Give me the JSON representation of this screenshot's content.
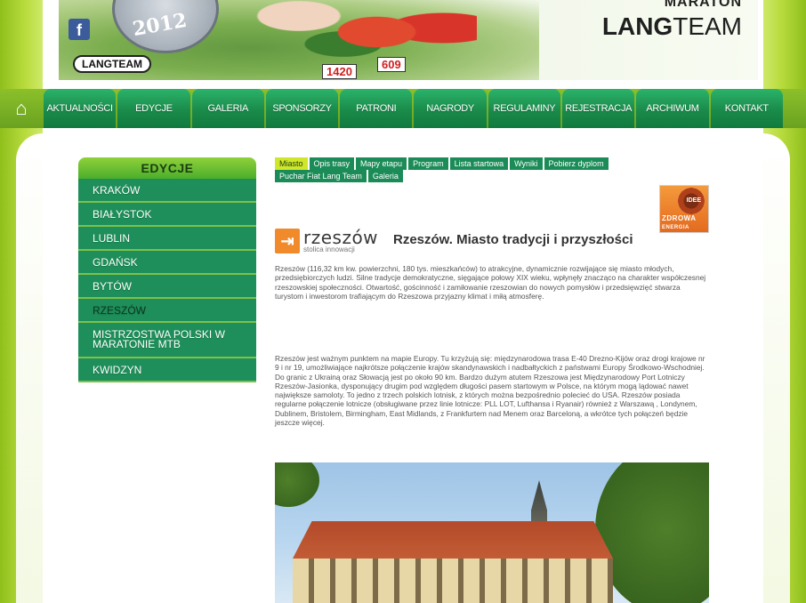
{
  "header": {
    "maraton_text": "MARATON",
    "logo_bold": "LANG",
    "logo_regular": "TEAM",
    "badge_text": "LANGTEAM",
    "medal_text": "2012",
    "fb_letter": "f",
    "bib_numbers": [
      "1420",
      "609"
    ]
  },
  "nav": {
    "home_icon": "⌂",
    "items": [
      "AKTUALNOŚCI",
      "EDYCJE",
      "GALERIA",
      "SPONSORZY",
      "PATRONI",
      "NAGRODY",
      "REGULAMINY",
      "REJESTRACJA",
      "ARCHIWUM",
      "KONTAKT"
    ]
  },
  "sidebar": {
    "title": "EDYCJE",
    "items": [
      {
        "label": "KRAKÓW",
        "active": false
      },
      {
        "label": "BIAŁYSTOK",
        "active": false
      },
      {
        "label": "LUBLIN",
        "active": false
      },
      {
        "label": "GDAŃSK",
        "active": false
      },
      {
        "label": "BYTÓW",
        "active": false
      },
      {
        "label": "RZESZÓW",
        "active": true
      },
      {
        "label": "MISTRZOSTWA POLSKI W MARATONIE MTB",
        "active": false
      },
      {
        "label": "KWIDZYN",
        "active": false
      }
    ]
  },
  "tabs": {
    "row1": [
      "Miasto",
      "Opis trasy",
      "Mapy etapu",
      "Program",
      "Lista startowa",
      "Wyniki",
      "Pobierz dyplom"
    ],
    "row2": [
      "Puchar Fiat Lang Team",
      "Galeria"
    ],
    "active": "Miasto"
  },
  "sponsor": {
    "badge": "IDEE",
    "name": "ZDROWA",
    "sub": "ENERGIA"
  },
  "city_logo": {
    "icon": "⇥",
    "name": "rzeszów",
    "tagline": "stolica innowacji"
  },
  "content": {
    "title": "Rzeszów. Miasto tradycji i przyszłości",
    "paragraph1": "Rzeszów (116,32 km kw. powierzchni, 180 tys. mieszkańców) to atrakcyjne, dynamicznie rozwijające się miasto młodych, przedsiębiorczych ludzi. Silne tradycje demokratyczne, sięgające połowy XIX wieku, wpłynęły znacząco na charakter współczesnej rzeszowskiej społeczności. Otwartość, gościnność i zamiłowanie rzeszowian do nowych pomysłów i przedsięwzięć stwarza turystom i inwestorom trafiającym do Rzeszowa przyjazny klimat i miłą atmosferę.",
    "paragraph2": "Rzeszów jest ważnym punktem na mapie Europy. Tu krzyżują się: międzynarodowa trasa E-40 Drezno-Kijów oraz drogi krajowe nr 9 i nr 19, umożliwiające najkrótsze połączenie krajów skandynawskich i nadbałtyckich z państwami Europy Środkowo-Wschodniej. Do granic z Ukrainą oraz Słowacją jest po około 90 km. Bardzo dużym atutem Rzeszowa jest Międzynarodowy Port Lotniczy Rzeszów-Jasionka, dysponujący drugim pod względem długości pasem startowym w Polsce, na którym mogą lądować nawet największe samoloty. To jedno z trzech polskich lotnisk, z których można bezpośrednio polecieć do USA. Rzeszów posiada regularne połączenie lotnicze (obsługiwane przez linie lotnicze: PLL LOT, Lufthansa i Ryanair) również z Warszawą , Londynem, Dublinem, Bristolem, Birmingham, East Midlands, z Frankfurtem nad Menem oraz Barceloną, a wkrótce tych połączeń będzie jeszcze więcej."
  },
  "colors": {
    "nav_green": "#1a8b4a",
    "frame_lime": "#b9dc3e",
    "tab_active": "#cfe62a",
    "sidebar_green": "#1e8f5a"
  }
}
